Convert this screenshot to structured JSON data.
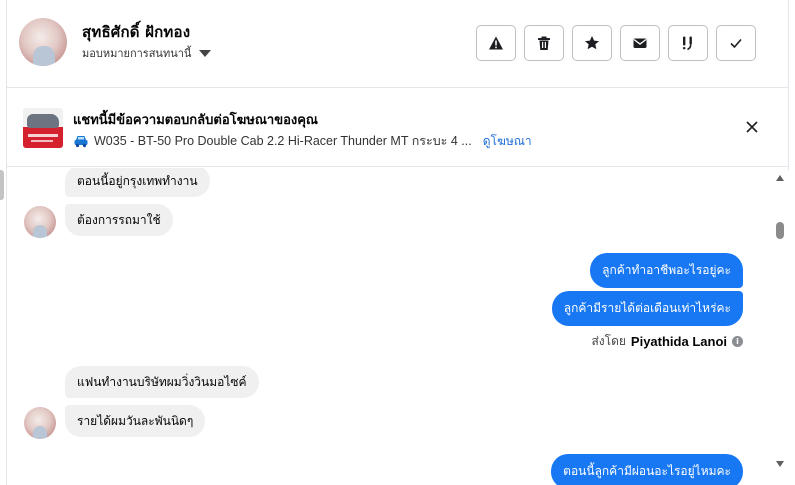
{
  "header": {
    "contact_name": "สุทธิศักดิ์ ฝักทอง",
    "assign_label": "มอบหมายการสนทนานี้",
    "tools": [
      {
        "icon": "warning-icon",
        "name": "report-spam-button"
      },
      {
        "icon": "trash-icon",
        "name": "delete-button"
      },
      {
        "icon": "star-icon",
        "name": "star-button"
      },
      {
        "icon": "envelope-icon",
        "name": "mark-unread-button"
      },
      {
        "icon": "follow-up-icon",
        "name": "follow-up-button"
      },
      {
        "icon": "check-icon",
        "name": "mark-done-button"
      }
    ]
  },
  "banner": {
    "title": "แชทนี้มีข้อความตอบกลับต่อโฆษณาของคุณ",
    "ad_description": "W035 - BT-50 Pro Double Cab 2.2 Hi-Racer Thunder MT กระบะ 4 ...",
    "view_ad_link": "ดูโฆษณา"
  },
  "thread": {
    "messages": [
      {
        "direction": "in",
        "text": "ตอนนี้อยู่กรุงเทพทำงาน"
      },
      {
        "direction": "in",
        "text": "ต้องการรถมาใช้"
      },
      {
        "direction": "out",
        "text": "ลูกค้าทำอาชีพอะไรอยู่คะ"
      },
      {
        "direction": "out",
        "text": "ลูกค้ามีรายได้ต่อเดือนเท่าไหร่คะ"
      },
      {
        "direction": "in",
        "text": "แฟนทำงานบริษัทผมวิ่งวินมอไซค์"
      },
      {
        "direction": "in",
        "text": "รายได้ผมวันละพันนิดๆ"
      },
      {
        "direction": "out",
        "text": "ตอนนี้ลูกค้ามีผ่อนอะไรอยู่ไหมคะ"
      }
    ],
    "sent_by_label": "ส่งโดย",
    "sent_by_agent": "Piyathida Lanoi"
  },
  "colors": {
    "accent": "#1877f2",
    "incoming_bubble": "#f0f0f0",
    "link": "#216fdb"
  }
}
